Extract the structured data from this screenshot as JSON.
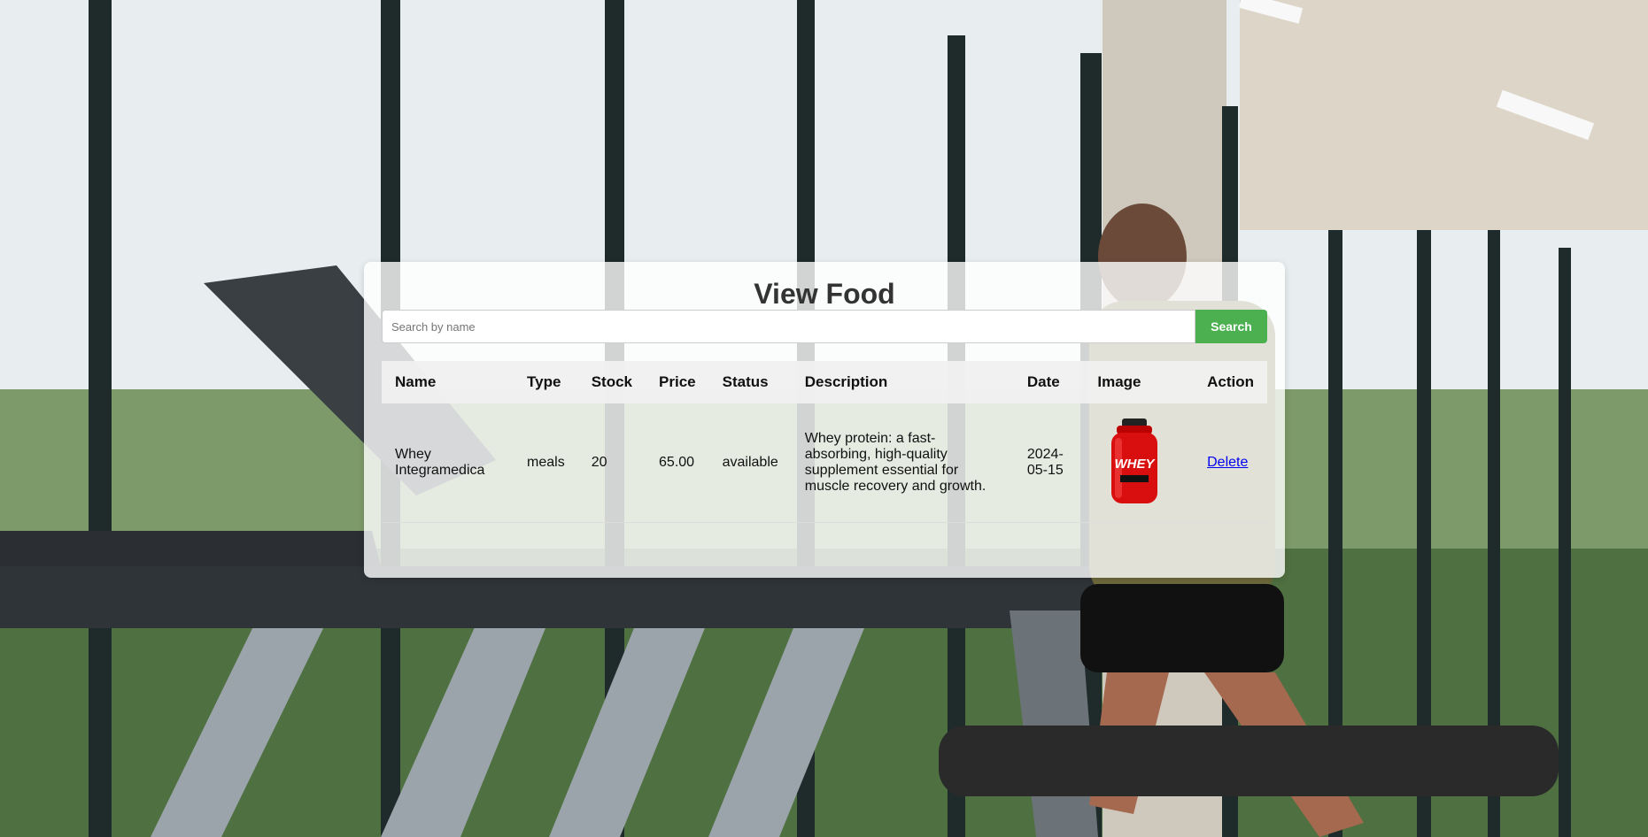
{
  "page": {
    "title": "View Food"
  },
  "search": {
    "placeholder": "Search by name",
    "button_label": "Search"
  },
  "table": {
    "headers": [
      "Name",
      "Type",
      "Stock",
      "Price",
      "Status",
      "Description",
      "Date",
      "Image",
      "Action"
    ],
    "rows": [
      {
        "name": "Whey Integramedica",
        "type": "meals",
        "stock": "20",
        "price": "65.00",
        "status": "available",
        "description": "Whey protein: a fast-absorbing, high-quality supplement essential for muscle recovery and growth.",
        "date": "2024-05-15",
        "image_label": "WHEY",
        "action_label": "Delete"
      }
    ]
  },
  "colors": {
    "accent": "#4caf50",
    "link": "#0000ee",
    "title_text": "#333333"
  }
}
